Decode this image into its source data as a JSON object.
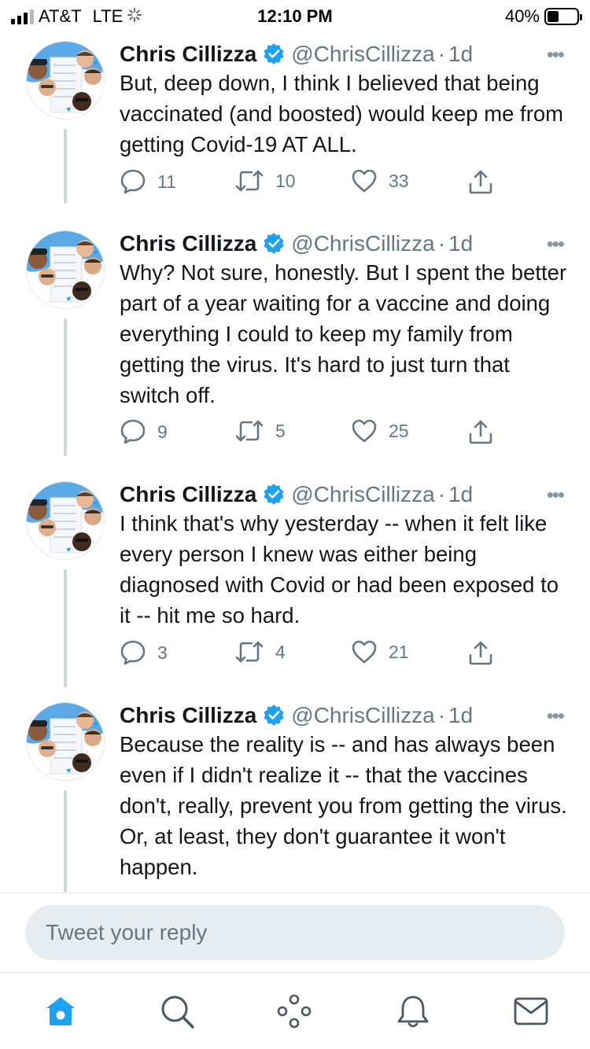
{
  "status_bar": {
    "carrier": "AT&T",
    "network": "LTE",
    "time": "12:10 PM",
    "battery_percent": "40%",
    "battery_level": 0.4
  },
  "tweets": [
    {
      "name": "Chris Cillizza",
      "handle": "@ChrisCillizza",
      "separator": "·",
      "time": "1d",
      "text": "But, deep down, I think I believed that being vaccinated (and boosted) would keep me from getting Covid-19 AT ALL.",
      "replies": "11",
      "retweets": "10",
      "likes": "33"
    },
    {
      "name": "Chris Cillizza",
      "handle": "@ChrisCillizza",
      "separator": "·",
      "time": "1d",
      "text": "Why? Not sure, honestly. But I spent the better part of a year waiting for a vaccine and doing everything I could to keep my family from getting the virus.  It's hard to just turn that switch off.",
      "replies": "9",
      "retweets": "5",
      "likes": "25"
    },
    {
      "name": "Chris Cillizza",
      "handle": "@ChrisCillizza",
      "separator": "·",
      "time": "1d",
      "text": "I think that's why yesterday -- when it felt like every person I knew was either being diagnosed with Covid or had been exposed to it -- hit me so hard.",
      "replies": "3",
      "retweets": "4",
      "likes": "21"
    },
    {
      "name": "Chris Cillizza",
      "handle": "@ChrisCillizza",
      "separator": "·",
      "time": "1d",
      "text": "Because the reality is -- and has always been even if I didn't realize it -- that the vaccines don't, really, prevent you from getting the virus. Or, at least, they don't guarantee it won't happen.",
      "replies": "",
      "retweets": "",
      "likes": ""
    }
  ],
  "reply": {
    "placeholder": "Tweet your reply"
  },
  "tabbar": {
    "items": [
      "home-icon",
      "search-icon",
      "spaces-icon",
      "notifications-icon",
      "messages-icon"
    ],
    "active": "home-icon"
  },
  "colors": {
    "accent": "#1da1f2",
    "text": "#14171a",
    "secondary": "#657786",
    "thread_line": "#ccd6dd",
    "input_bg": "#e6ecf0"
  }
}
